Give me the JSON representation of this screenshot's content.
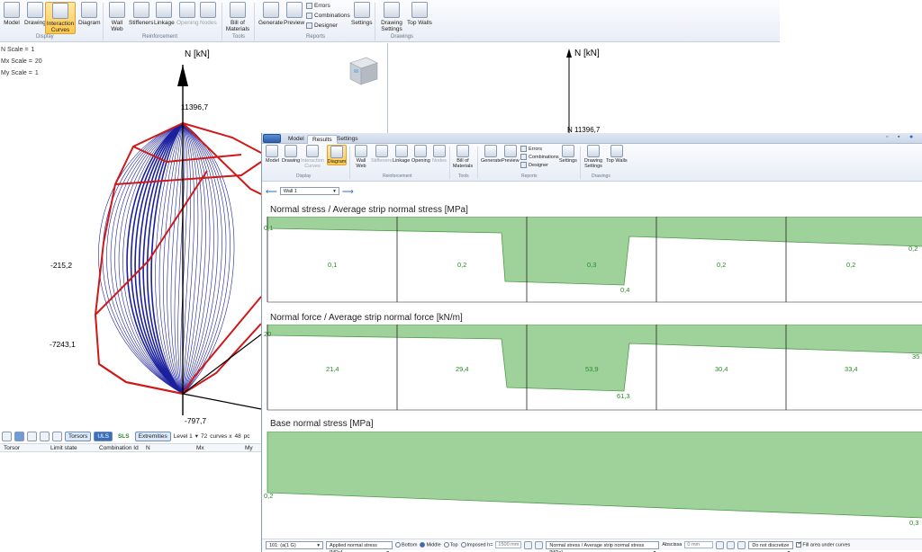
{
  "colors": {
    "accent": "#2f69c2",
    "fill": "#9fd29a",
    "fill_stroke": "#4f9a4b",
    "curve_blue": "#1a1f9e",
    "curve_red": "#d01818",
    "value_green": "#2a8a2a"
  },
  "back_ribbon": {
    "buttons": [
      {
        "label": "Model",
        "icon": "model-icon"
      },
      {
        "label": "Drawing",
        "icon": "drawing-icon"
      },
      {
        "label": "Interaction Curves",
        "icon": "interaction-curves-icon"
      },
      {
        "label": "Diagram",
        "icon": "diagram-icon"
      },
      {
        "label": "Wall Web",
        "icon": "wall-web-icon"
      },
      {
        "label": "Stiffeners",
        "icon": "stiffeners-icon"
      },
      {
        "label": "Linkage",
        "icon": "linkage-icon"
      },
      {
        "label": "Opening",
        "icon": "opening-icon"
      },
      {
        "label": "Nodes",
        "icon": "nodes-icon"
      },
      {
        "label": "Bill of Materials",
        "icon": "bill-of-materials-icon"
      },
      {
        "label": "Generate",
        "icon": "generate-icon"
      },
      {
        "label": "Preview",
        "icon": "preview-icon"
      },
      {
        "label": "Settings",
        "icon": "settings-icon"
      },
      {
        "label": "Drawing Settings",
        "icon": "drawing-settings-icon"
      },
      {
        "label": "Top Walls",
        "icon": "top-walls-icon"
      }
    ],
    "small_items": [
      "Errors",
      "Combinations",
      "Designer"
    ],
    "groups": [
      "Display",
      "Reinforcement",
      "Tools",
      "Reports",
      "Drawings"
    ]
  },
  "scales": {
    "n_label": "N Scale =",
    "n_value": "1",
    "mx_label": "Mx Scale =",
    "mx_value": "20",
    "my_label": "My Scale =",
    "my_value": "1"
  },
  "left_plot": {
    "axis_label": "N [kN]",
    "top_value": "11396,7",
    "bottom_value": "-797,7",
    "left_value_1": "-215,2",
    "left_value_2": "-7243,1"
  },
  "right_axis": {
    "label": "N [kN]",
    "value": "N 11396,7"
  },
  "left_toolbar": {
    "torsors": "Torsors",
    "uls": "ULS",
    "sls": "SLS",
    "extremities": "Extremities",
    "level": "Level 1",
    "curves": "72",
    "curves_text": "curves x",
    "points": "48",
    "points_text": "pc"
  },
  "left_table_headers": [
    "Torsor",
    "Limit state",
    "Combination Id",
    "N",
    "Mx",
    "My"
  ],
  "window": {
    "tabs": [
      "Model",
      "Results",
      "Settings"
    ],
    "wall_selector": "Wall 1",
    "ribbon_buttons": [
      {
        "label": "Model",
        "icon": "model-icon"
      },
      {
        "label": "Drawing",
        "icon": "drawing-icon"
      },
      {
        "label": "Interaction Curves",
        "icon": "interaction-curves-icon"
      },
      {
        "label": "Diagram",
        "icon": "diagram-icon"
      },
      {
        "label": "Wall Web",
        "icon": "wall-web-icon"
      },
      {
        "label": "Stiffeners",
        "icon": "stiffeners-icon"
      },
      {
        "label": "Linkage",
        "icon": "linkage-icon"
      },
      {
        "label": "Opening",
        "icon": "opening-icon"
      },
      {
        "label": "Nodes",
        "icon": "nodes-icon"
      },
      {
        "label": "Bill of Materials",
        "icon": "bill-of-materials-icon"
      },
      {
        "label": "Generate",
        "icon": "generate-icon"
      },
      {
        "label": "Preview",
        "icon": "preview-icon"
      },
      {
        "label": "Settings",
        "icon": "settings-icon"
      },
      {
        "label": "Drawing Settings",
        "icon": "drawing-settings-icon"
      },
      {
        "label": "Top Walls",
        "icon": "top-walls-icon"
      }
    ],
    "small_items": [
      "Errors",
      "Combinations",
      "Designer"
    ],
    "groups": [
      "Display",
      "Reinforcement",
      "Tools",
      "Reports",
      "Drawings"
    ]
  },
  "diagrams": [
    {
      "title": "Normal stress / Average strip normal stress [MPa]",
      "start_label": "0,1",
      "end_label": "0,2",
      "dip_label": "0,4",
      "strip_values": [
        "0,1",
        "0,2",
        "0,3",
        "0,2",
        "0,2"
      ]
    },
    {
      "title": "Normal force / Average strip normal force [kN/m]",
      "start_label": "20",
      "end_label": "35",
      "dip_label": "61,3",
      "strip_values": [
        "21,4",
        "29,4",
        "53,9",
        "30,4",
        "33,4"
      ]
    },
    {
      "title": "Base normal stress [MPa]",
      "start_label": "0,2",
      "end_label": "0,3"
    }
  ],
  "bottom_toolbar": {
    "combination": "101: (a(1 G)",
    "stress_type": "Applied normal stress [MPa]",
    "radio_bottom": "Bottom",
    "radio_middle": "Middle",
    "radio_top": "Top",
    "radio_imposed": "Imposed h=",
    "imposed_value": "1500 mm",
    "diagram_select": "Normal stress / Average strip normal stress [MPa]",
    "abscissa_label": "Abscissa",
    "abscissa_value": "0 mm",
    "discretize": "Do not discretize",
    "fill_label": "Fill area under curves"
  }
}
